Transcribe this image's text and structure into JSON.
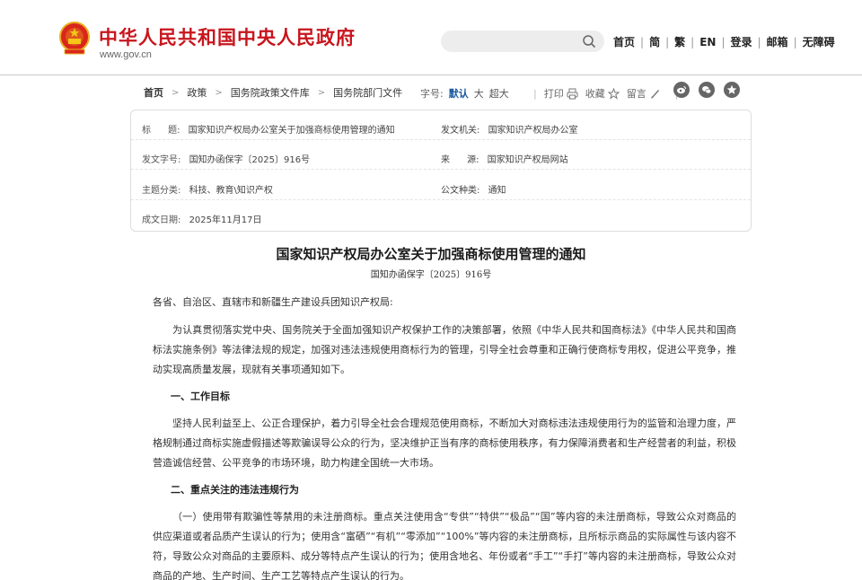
{
  "header": {
    "site_title": "中华人民共和国中央人民政府",
    "site_url": "www.gov.cn",
    "search_placeholder": "",
    "nav": [
      "首页",
      "简",
      "繁",
      "EN",
      "登录",
      "邮箱",
      "无障碍"
    ]
  },
  "breadcrumb": [
    "首页",
    "政策",
    "国务院政策文件库",
    "国务院部门文件"
  ],
  "font_size": {
    "label": "字号:",
    "options": [
      "默认",
      "大",
      "超大"
    ],
    "selected": "默认"
  },
  "tools": {
    "print": "打印",
    "favorite": "收藏",
    "comment": "留言"
  },
  "share_icons": [
    "weibo-icon",
    "wechat-icon",
    "qzone-icon"
  ],
  "meta": {
    "title_label": "标      题:",
    "title_value": "国家知识产权局办公室关于加强商标使用管理的通知",
    "issuer_label": "发文机关:",
    "issuer_value": "国家知识产权局办公室",
    "docno_label": "发文字号:",
    "docno_value": "国知办函保字〔2025〕916号",
    "source_label": "来      源:",
    "source_value": "国家知识产权局网站",
    "topic_label": "主题分类:",
    "topic_value": "科技、教育\\知识产权",
    "doctype_label": "公文种类:",
    "doctype_value": "通知",
    "date_label": "成文日期:",
    "date_value": "2025年11月17日"
  },
  "document": {
    "title": "国家知识产权局办公室关于加强商标使用管理的通知",
    "number": "国知办函保字〔2025〕916号",
    "salutation": "各省、自治区、直辖市和新疆生产建设兵团知识产权局:",
    "intro": "为认真贯彻落实党中央、国务院关于全面加强知识产权保护工作的决策部署，依照《中华人民共和国商标法》《中华人民共和国商标法实施条例》等法律法规的规定，加强对违法违规使用商标行为的管理，引导全社会尊重和正确行使商标专用权，促进公平竞争，推动实现高质量发展，现就有关事项通知如下。",
    "section1_heading": "一、工作目标",
    "section1_text": "坚持人民利益至上、公正合理保护，着力引导全社会合理规范使用商标，不断加大对商标违法违规使用行为的监管和治理力度，严格规制通过商标实施虚假描述等欺骗误导公众的行为，坚决维护正当有序的商标使用秩序，有力保障消费者和生产经营者的利益，积极营造诚信经营、公平竞争的市场环境，助力构建全国统一大市场。",
    "section2_heading": "二、重点关注的违法违规行为",
    "section2_text": "（一）使用带有欺骗性等禁用的未注册商标。重点关注使用含“专供”“特供”“极品”“国”等内容的未注册商标，导致公众对商品的供应渠道或者品质产生误认的行为；使用含“富硒”“有机”“零添加”“100%”等内容的未注册商标，且所标示商品的实际属性与该内容不符，导致公众对商品的主要原料、成分等特点产生误认的行为；使用含地名、年份或者“手工”“手打”等内容的未注册商标，导致公众对商品的产地、生产时间、生产工艺等特点产生误认的行为。"
  },
  "colors": {
    "brand_red": "#c8161d",
    "link_blue": "#1a5aa0"
  }
}
